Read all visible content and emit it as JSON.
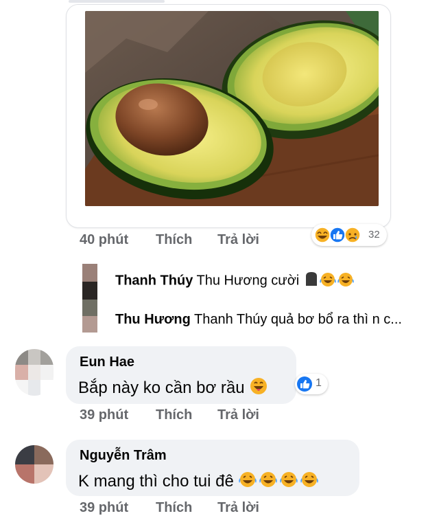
{
  "post_meta": {
    "time": "40 phút",
    "like": "Thích",
    "reply": "Trả lời",
    "reaction_count": "32"
  },
  "replies": [
    {
      "author": "Thanh Thúy",
      "text": "Thu Hương cười"
    },
    {
      "author": "Thu Hương",
      "text": "Thanh Thúy  quả bơ bổ ra thì n c..."
    }
  ],
  "comments": [
    {
      "author": "Eun Hae",
      "text": "Bắp này ko cần bơ rầu",
      "like_count": "1",
      "time": "39 phút",
      "like": "Thích",
      "reply": "Trả lời"
    },
    {
      "author": "Nguyễn Trâm",
      "text": "K mang thì cho tui đê",
      "time": "39 phút",
      "like": "Thích",
      "reply": "Trả lời"
    }
  ],
  "colors": {
    "laugh": "#f7b125",
    "like_blue": "#1877f2",
    "meta_gray": "#65676b",
    "bubble_bg": "#f0f2f5"
  }
}
